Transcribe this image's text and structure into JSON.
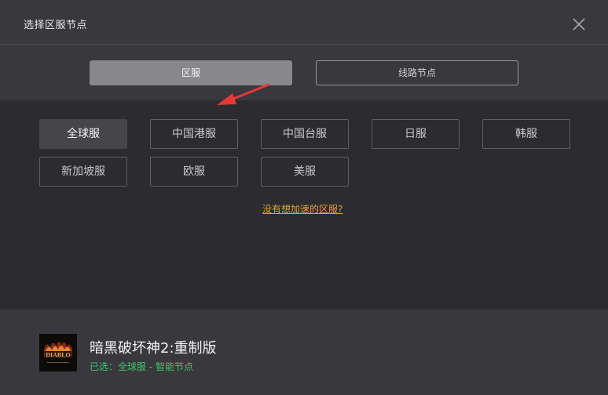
{
  "dialog": {
    "title": "选择区服节点"
  },
  "segments": {
    "region_label": "区服",
    "route_label": "线路节点"
  },
  "regions": [
    {
      "label": "全球服"
    },
    {
      "label": "中国港服"
    },
    {
      "label": "中国台服"
    },
    {
      "label": "日服"
    },
    {
      "label": "韩服"
    },
    {
      "label": "新加坡服"
    },
    {
      "label": "欧服"
    },
    {
      "label": "美服"
    }
  ],
  "help_link": "没有想加速的区服?",
  "game": {
    "name": "暗黑破坏神2:重制版",
    "status": "已选：全球服 - 智能节点",
    "icon": "diablo-ii-resurrected-logo"
  },
  "colors": {
    "accent": "#e0a33c",
    "status_green": "#3ec86c",
    "active_tab": "#88888c",
    "arrow_red": "#e53935"
  }
}
